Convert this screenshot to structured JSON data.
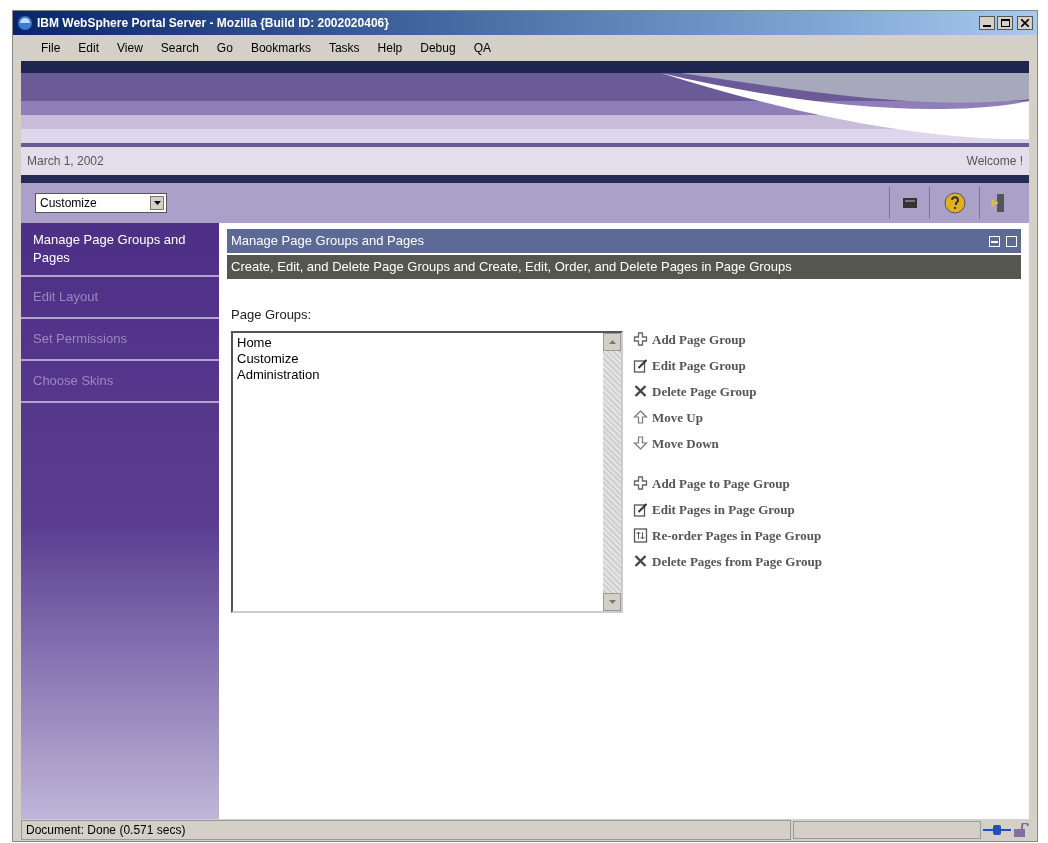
{
  "window": {
    "title": "IBM WebSphere Portal Server - Mozilla {Build ID: 2002020406}"
  },
  "menu": [
    "File",
    "Edit",
    "View",
    "Search",
    "Go",
    "Bookmarks",
    "Tasks",
    "Help",
    "Debug",
    "QA"
  ],
  "date": "March 1, 2002",
  "welcome": "Welcome !",
  "place_select": {
    "value": "Customize"
  },
  "sidebar": {
    "items": [
      {
        "label": "Manage Page Groups and Pages",
        "selected": true
      },
      {
        "label": "Edit Layout",
        "selected": false
      },
      {
        "label": "Set Permissions",
        "selected": false
      },
      {
        "label": "Choose Skins",
        "selected": false
      }
    ]
  },
  "portlet": {
    "title": "Manage Page Groups and Pages",
    "description": "Create, Edit, and Delete Page Groups and Create, Edit, Order, and Delete Pages in Page Groups",
    "list_label": "Page Groups:",
    "list_items": [
      "Home",
      "Customize",
      "Administration"
    ],
    "action_groups": [
      [
        {
          "kind": "add",
          "label": "Add Page Group"
        },
        {
          "kind": "edit",
          "label": "Edit Page Group"
        },
        {
          "kind": "delete",
          "label": "Delete Page Group"
        },
        {
          "kind": "up",
          "label": "Move Up"
        },
        {
          "kind": "down",
          "label": "Move Down"
        }
      ],
      [
        {
          "kind": "add",
          "label": "Add Page to Page Group"
        },
        {
          "kind": "edit",
          "label": "Edit Pages in Page Group"
        },
        {
          "kind": "reorder",
          "label": "Re-order Pages in Page Group"
        },
        {
          "kind": "delete",
          "label": "Delete Pages from Page Group"
        }
      ]
    ]
  },
  "status_bar": {
    "text": "Document: Done (0.571 secs)"
  }
}
